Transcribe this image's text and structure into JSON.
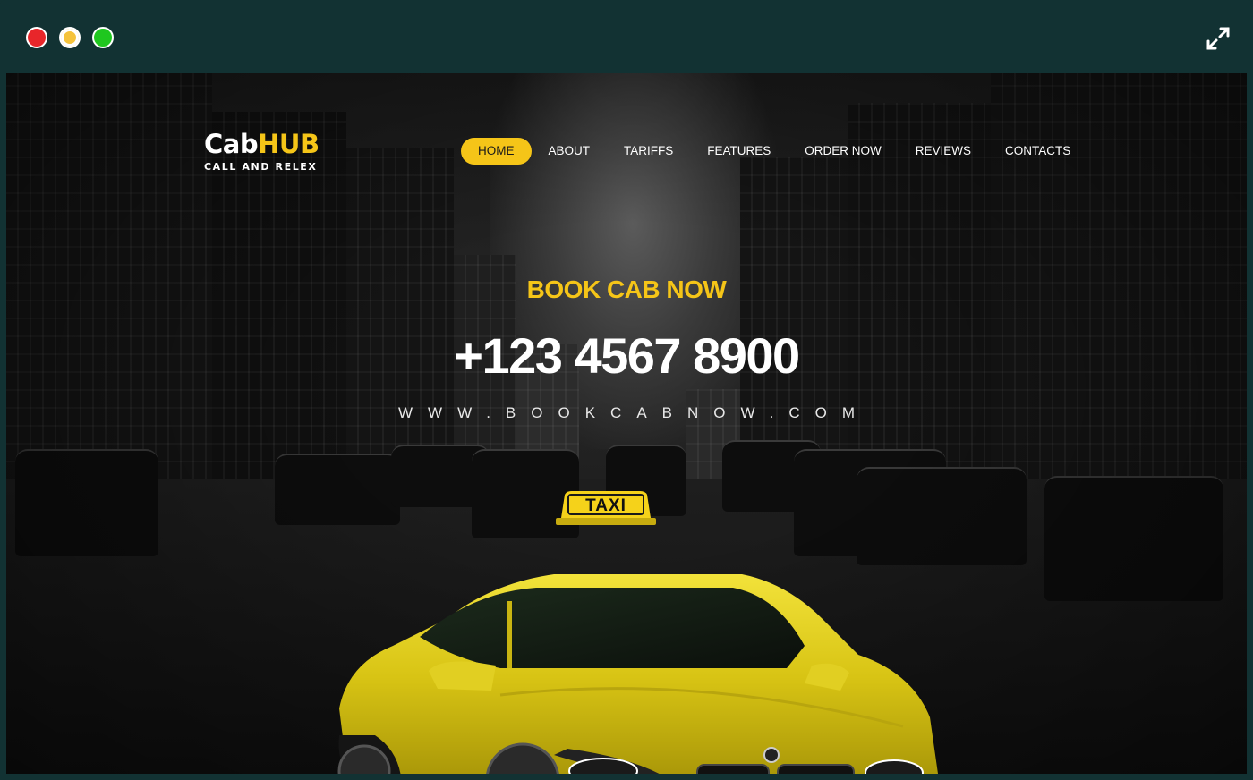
{
  "brand": {
    "name_part1": "Cab",
    "name_part2": "HUB",
    "tagline": "CALL AND RELEX"
  },
  "nav": {
    "items": [
      {
        "label": "HOME",
        "active": true
      },
      {
        "label": "ABOUT"
      },
      {
        "label": "TARIFFS"
      },
      {
        "label": "FEATURES"
      },
      {
        "label": "ORDER NOW"
      },
      {
        "label": "REVIEWS"
      },
      {
        "label": "CONTACTS"
      }
    ]
  },
  "hero": {
    "title": "BOOK CAB NOW",
    "phone": "+123 4567 8900",
    "website": "WWW.BOOKCABNOW.COM",
    "taxi_sign": "TAXI"
  },
  "colors": {
    "accent": "#f5c518",
    "chrome_bg": "#123233",
    "text": "#ffffff"
  },
  "icons": {
    "expand": "expand-icon",
    "close": "close-dot",
    "minimize": "minimize-dot",
    "maximize": "maximize-dot"
  }
}
